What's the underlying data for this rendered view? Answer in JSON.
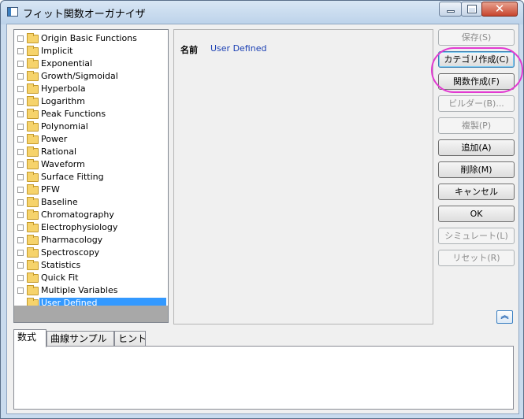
{
  "window": {
    "title": "フィット関数オーガナイザ"
  },
  "tree": {
    "items": [
      {
        "label": "Origin Basic Functions"
      },
      {
        "label": "Implicit"
      },
      {
        "label": "Exponential"
      },
      {
        "label": "Growth/Sigmoidal"
      },
      {
        "label": "Hyperbola"
      },
      {
        "label": "Logarithm"
      },
      {
        "label": "Peak Functions"
      },
      {
        "label": "Polynomial"
      },
      {
        "label": "Power"
      },
      {
        "label": "Rational"
      },
      {
        "label": "Waveform"
      },
      {
        "label": "Surface Fitting"
      },
      {
        "label": "PFW"
      },
      {
        "label": "Baseline"
      },
      {
        "label": "Chromatography"
      },
      {
        "label": "Electrophysiology"
      },
      {
        "label": "Pharmacology"
      },
      {
        "label": "Spectroscopy"
      },
      {
        "label": "Statistics"
      },
      {
        "label": "Quick Fit"
      },
      {
        "label": "Multiple Variables"
      },
      {
        "label": "User Defined",
        "selected": true
      }
    ]
  },
  "detail": {
    "name_label": "名前",
    "name_value": "User Defined"
  },
  "buttons": {
    "save": "保存(S)",
    "new_category": "カテゴリ作成(C)",
    "new_function": "関数作成(F)",
    "builder": "ビルダー(B)...",
    "duplicate": "複製(P)",
    "add": "追加(A)",
    "delete": "削除(M)",
    "cancel": "キャンセル",
    "ok": "OK",
    "simulate": "シミュレート(L)",
    "reset": "リセット(R)"
  },
  "tabs": [
    {
      "label": "数式",
      "selected": true
    },
    {
      "label": "曲線サンプル"
    },
    {
      "label": "ヒント"
    }
  ],
  "colors": {
    "accent": "#3399ff",
    "highlight_ring": "#e23ad1",
    "name_value": "#1a3fb3"
  }
}
